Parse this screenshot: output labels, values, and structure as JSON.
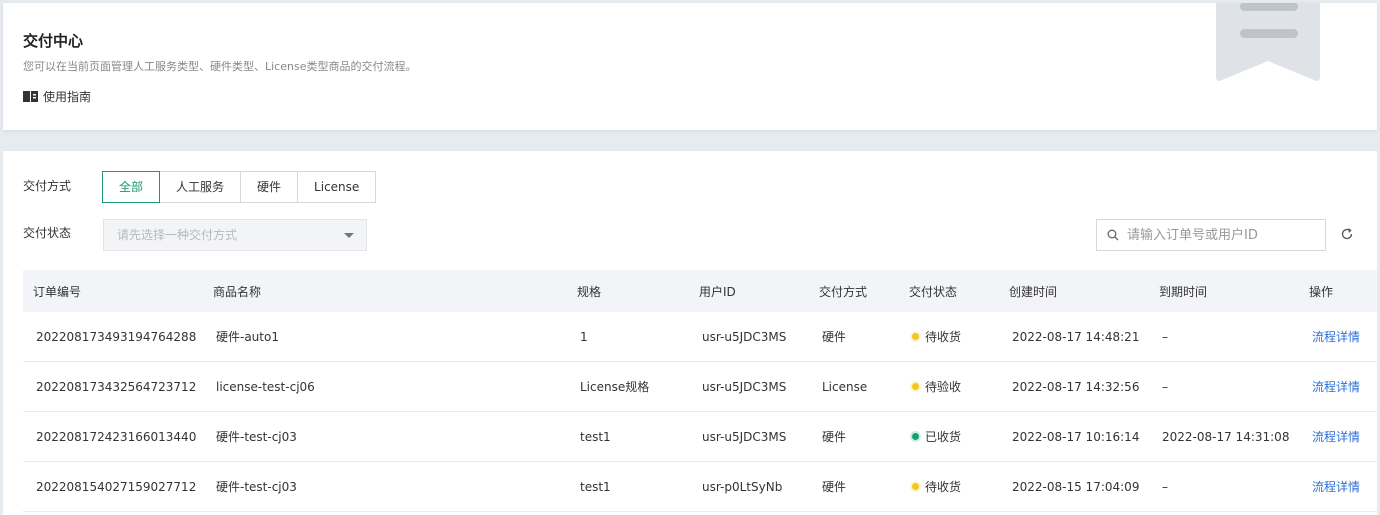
{
  "header": {
    "title": "交付中心",
    "description": "您可以在当前页面管理人工服务类型、硬件类型、License类型商品的交付流程。",
    "guide_label": "使用指南"
  },
  "filters": {
    "method_label": "交付方式",
    "method_options": [
      "全部",
      "人工服务",
      "硬件",
      "License"
    ],
    "status_label": "交付状态",
    "status_placeholder": "请先选择一种交付方式"
  },
  "search": {
    "placeholder": "请输入订单号或用户ID"
  },
  "table": {
    "columns": [
      "订单编号",
      "商品名称",
      "规格",
      "用户ID",
      "交付方式",
      "交付状态",
      "创建时间",
      "到期时间",
      "操作"
    ],
    "rows": [
      {
        "order_id": "2022081734931947642​88",
        "product": "硬件-auto1",
        "spec": "1",
        "user_id": "usr-u5JDC3MS",
        "method": "硬件",
        "status": "待收货",
        "status_color": "#f5c518",
        "created": "2022-08-17 14:48:21",
        "expires": "–",
        "action": "流程详情"
      },
      {
        "order_id": "2022081734325647237​12",
        "product": "license-test-cj06",
        "spec": "License规格",
        "user_id": "usr-u5JDC3MS",
        "method": "License",
        "status": "待验收",
        "status_color": "#f5c518",
        "created": "2022-08-17 14:32:56",
        "expires": "–",
        "action": "流程详情"
      },
      {
        "order_id": "2022081724231660134​40",
        "product": "硬件-test-cj03",
        "spec": "test1",
        "user_id": "usr-u5JDC3MS",
        "method": "硬件",
        "status": "已收货",
        "status_color": "#13a36f",
        "created": "2022-08-17 10:16:14",
        "expires": "2022-08-17 14:31:08",
        "action": "流程详情"
      },
      {
        "order_id": "2022081540271590277​12",
        "product": "硬件-test-cj03",
        "spec": "test1",
        "user_id": "usr-p0LtSyNb",
        "method": "硬件",
        "status": "待收货",
        "status_color": "#f5c518",
        "created": "2022-08-15 17:04:09",
        "expires": "–",
        "action": "流程详情"
      }
    ]
  },
  "colors": {
    "accent": "#1a9a6c",
    "link": "#2a6fdb",
    "pending": "#f5c518",
    "done": "#13a36f"
  }
}
